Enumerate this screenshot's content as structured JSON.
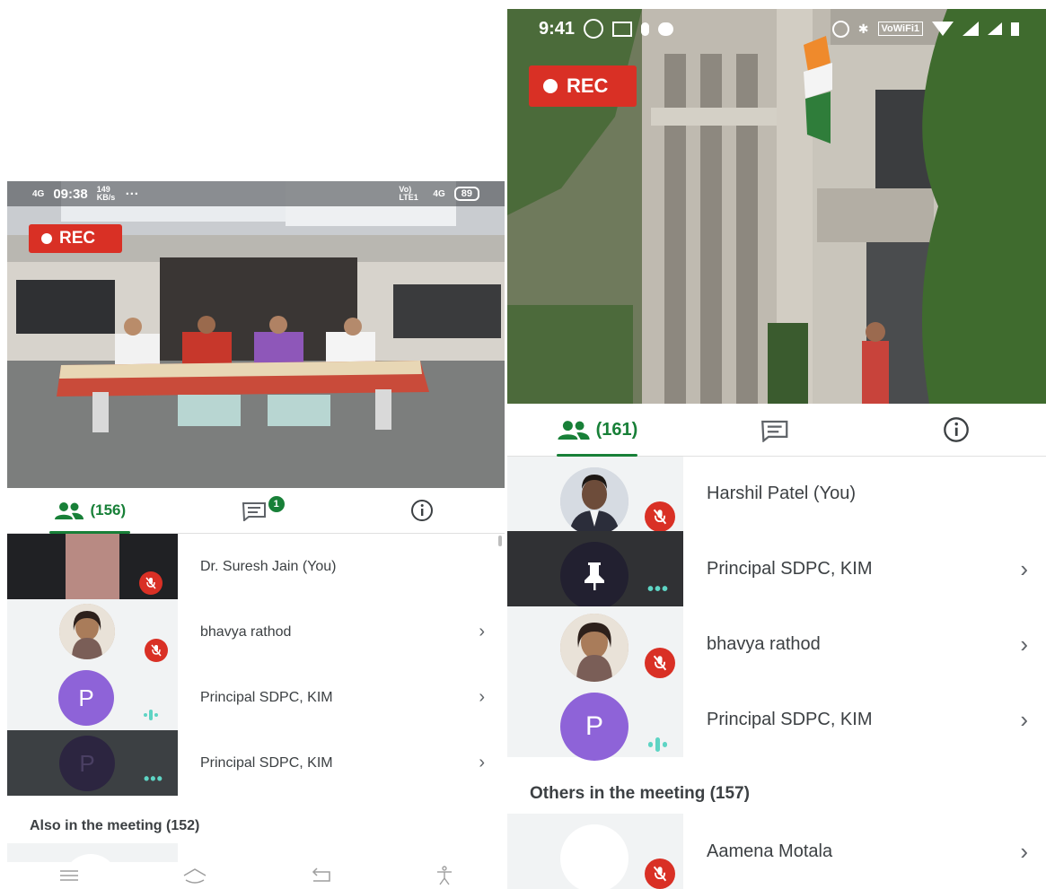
{
  "left": {
    "status": {
      "time": "09:38",
      "signal": "4G",
      "speed": "149 KB/s",
      "more": "···",
      "volte": "Vo) LTE1",
      "network": "4G",
      "battery": "89"
    },
    "rec_label": "REC",
    "tabs": {
      "people_count": "(156)",
      "chat_badge": "1"
    },
    "participants": [
      {
        "name": "Dr. Suresh Jain (You)"
      },
      {
        "name": "bhavya rathod"
      },
      {
        "name": "Principal SDPC, KIM",
        "initial": "P"
      },
      {
        "name": "Principal SDPC, KIM",
        "initial": "P"
      }
    ],
    "section_label": "Also in the meeting (152)"
  },
  "right": {
    "status": {
      "time": "9:41",
      "wifi_label": "VoWiFi1"
    },
    "rec_label": "REC",
    "tabs": {
      "people_count": "(161)"
    },
    "participants": [
      {
        "name": "Harshil Patel (You)"
      },
      {
        "name": "Principal SDPC, KIM"
      },
      {
        "name": "bhavya rathod"
      },
      {
        "name": "Principal SDPC, KIM",
        "initial": "P"
      }
    ],
    "section_label": "Others in the meeting (157)",
    "others": [
      {
        "name": "Aamena Motala"
      }
    ]
  },
  "colors": {
    "rec_red": "#d93025",
    "accent_green": "#188038",
    "avatar_purple": "#8e63d8",
    "speaking_teal": "#5ed4c4"
  },
  "icons": [
    "people-icon",
    "chat-icon",
    "info-icon",
    "mic-off-icon",
    "pin-icon",
    "chevron-right-icon",
    "menu-icon",
    "home-icon",
    "back-icon",
    "accessibility-icon"
  ]
}
